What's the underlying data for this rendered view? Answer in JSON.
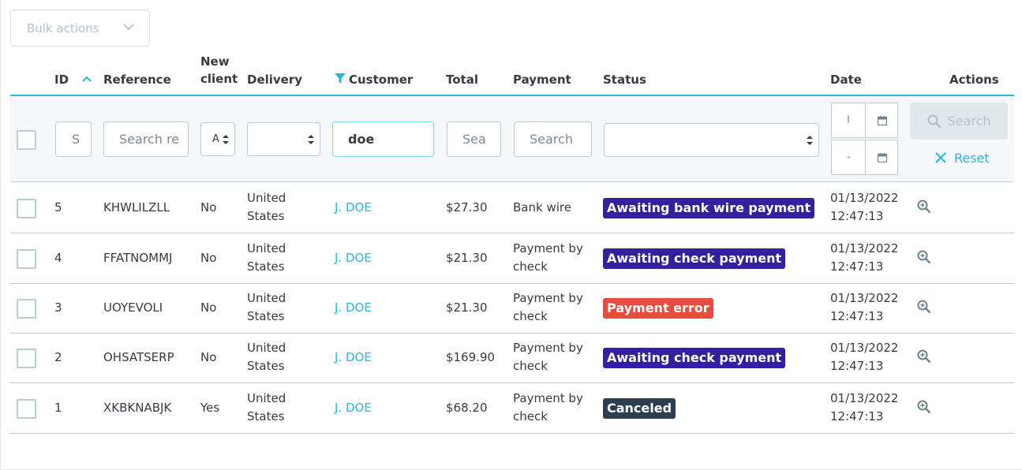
{
  "bulk_actions": {
    "label": "Bulk actions"
  },
  "columns": {
    "id": "ID",
    "reference": "Reference",
    "new_client_1": "New",
    "new_client_2": "client",
    "delivery": "Delivery",
    "customer": "Customer",
    "total": "Total",
    "payment": "Payment",
    "status": "Status",
    "date": "Date",
    "actions": "Actions"
  },
  "filters": {
    "id_placeholder": "S",
    "reference_placeholder": "Search re",
    "new_client_value": "A",
    "customer_value": "doe",
    "total_placeholder": "Sea",
    "payment_placeholder": "Search",
    "date_from": "I",
    "date_to": "-",
    "search_button": "Search",
    "reset_button": "Reset"
  },
  "colors": {
    "accent": "#25b9d7",
    "awaiting_bank_wire": "#34209e",
    "awaiting_check": "#34209e",
    "payment_error": "#e74c3c",
    "canceled": "#2c3e50"
  },
  "rows": [
    {
      "id": "5",
      "reference": "KHWLILZLL",
      "new_client": "No",
      "delivery_1": "United",
      "delivery_2": "States",
      "customer": "J. DOE",
      "total": "$27.30",
      "payment_1": "Bank wire",
      "payment_2": "",
      "status": "Awaiting bank wire payment",
      "date_1": "01/13/2022",
      "date_2": "12:47:13"
    },
    {
      "id": "4",
      "reference": "FFATNOMMJ",
      "new_client": "No",
      "delivery_1": "United",
      "delivery_2": "States",
      "customer": "J. DOE",
      "total": "$21.30",
      "payment_1": "Payment by",
      "payment_2": "check",
      "status": "Awaiting check payment",
      "date_1": "01/13/2022",
      "date_2": "12:47:13"
    },
    {
      "id": "3",
      "reference": "UOYEVOLI",
      "new_client": "No",
      "delivery_1": "United",
      "delivery_2": "States",
      "customer": "J. DOE",
      "total": "$21.30",
      "payment_1": "Payment by",
      "payment_2": "check",
      "status": "Payment error",
      "date_1": "01/13/2022",
      "date_2": "12:47:13"
    },
    {
      "id": "2",
      "reference": "OHSATSERP",
      "new_client": "No",
      "delivery_1": "United",
      "delivery_2": "States",
      "customer": "J. DOE",
      "total": "$169.90",
      "payment_1": "Payment by",
      "payment_2": "check",
      "status": "Awaiting check payment",
      "date_1": "01/13/2022",
      "date_2": "12:47:13"
    },
    {
      "id": "1",
      "reference": "XKBKNABJK",
      "new_client": "Yes",
      "delivery_1": "United",
      "delivery_2": "States",
      "customer": "J. DOE",
      "total": "$68.20",
      "payment_1": "Payment by",
      "payment_2": "check",
      "status": "Canceled",
      "date_1": "01/13/2022",
      "date_2": "12:47:13"
    }
  ]
}
